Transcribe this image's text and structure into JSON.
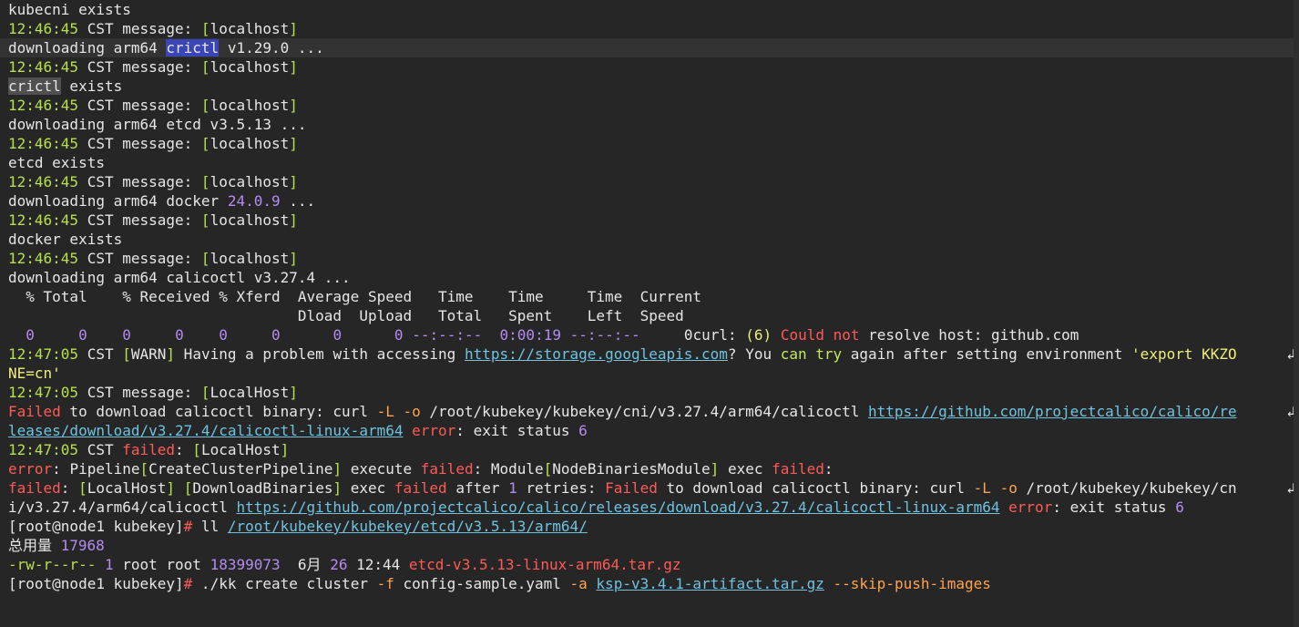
{
  "terminal": {
    "scrollbar": "vertical-scrollbar",
    "colors": {
      "background": "#262626",
      "text": "#e6e6e6",
      "timestamp": "#b8e04a",
      "error": "#ff5a55",
      "number": "#b48cf0",
      "link": "#6fc3df",
      "option": "#ffa34d",
      "green_word": "#c3e85c",
      "selection": "#3a45b8"
    },
    "lines": [
      [
        {
          "t": "kubecni exists"
        }
      ],
      [
        {
          "t": "12:46:45",
          "c": "t"
        },
        {
          "t": " CST message: "
        },
        {
          "t": "[",
          "c": "t"
        },
        {
          "t": "localhost"
        },
        {
          "t": "]",
          "c": "t"
        }
      ],
      [
        {
          "t": "downloading arm64 "
        },
        {
          "t": "crictl",
          "c": "sel"
        },
        {
          "t": " v1.29.0 ..."
        }
      ],
      [
        {
          "t": "12:46:45",
          "c": "t"
        },
        {
          "t": " CST message: "
        },
        {
          "t": "[",
          "c": "t"
        },
        {
          "t": "localhost"
        },
        {
          "t": "]",
          "c": "t"
        }
      ],
      [
        {
          "t": "crictl",
          "c": "sel2"
        },
        {
          "t": " exists"
        }
      ],
      [
        {
          "t": "12:46:45",
          "c": "t"
        },
        {
          "t": " CST message: "
        },
        {
          "t": "[",
          "c": "t"
        },
        {
          "t": "localhost"
        },
        {
          "t": "]",
          "c": "t"
        }
      ],
      [
        {
          "t": "downloading arm64 etcd v3.5.13 ..."
        }
      ],
      [
        {
          "t": "12:46:45",
          "c": "t"
        },
        {
          "t": " CST message: "
        },
        {
          "t": "[",
          "c": "t"
        },
        {
          "t": "localhost"
        },
        {
          "t": "]",
          "c": "t"
        }
      ],
      [
        {
          "t": "etcd exists"
        }
      ],
      [
        {
          "t": "12:46:45",
          "c": "t"
        },
        {
          "t": " CST message: "
        },
        {
          "t": "[",
          "c": "t"
        },
        {
          "t": "localhost"
        },
        {
          "t": "]",
          "c": "t"
        }
      ],
      [
        {
          "t": "downloading arm64 docker "
        },
        {
          "t": "24.0.9",
          "c": "p"
        },
        {
          "t": " ..."
        }
      ],
      [
        {
          "t": "12:46:45",
          "c": "t"
        },
        {
          "t": " CST message: "
        },
        {
          "t": "[",
          "c": "t"
        },
        {
          "t": "localhost"
        },
        {
          "t": "]",
          "c": "t"
        }
      ],
      [
        {
          "t": "docker exists"
        }
      ],
      [
        {
          "t": "12:46:45",
          "c": "t"
        },
        {
          "t": " CST message: "
        },
        {
          "t": "[",
          "c": "t"
        },
        {
          "t": "localhost"
        },
        {
          "t": "]",
          "c": "t"
        }
      ],
      [
        {
          "t": "downloading arm64 calicoctl v3.27.4 ..."
        }
      ],
      [
        {
          "t": "  % Total    % Received % Xferd  Average Speed   Time    Time     Time  Current"
        }
      ],
      [
        {
          "t": "                                 Dload  Upload   Total   Spent    Left  Speed"
        }
      ],
      [
        {
          "t": "  "
        },
        {
          "t": "0",
          "c": "p"
        },
        {
          "t": "     "
        },
        {
          "t": "0",
          "c": "p"
        },
        {
          "t": "    "
        },
        {
          "t": "0",
          "c": "p"
        },
        {
          "t": "     "
        },
        {
          "t": "0",
          "c": "p"
        },
        {
          "t": "    "
        },
        {
          "t": "0",
          "c": "p"
        },
        {
          "t": "     "
        },
        {
          "t": "0",
          "c": "p"
        },
        {
          "t": "      "
        },
        {
          "t": "0",
          "c": "p"
        },
        {
          "t": "      "
        },
        {
          "t": "0",
          "c": "p"
        },
        {
          "t": " "
        },
        {
          "t": "--:--:--",
          "c": "p"
        },
        {
          "t": "  "
        },
        {
          "t": "0:00:19",
          "c": "p"
        },
        {
          "t": " "
        },
        {
          "t": "--:--:--",
          "c": "p"
        },
        {
          "t": "     0curl: "
        },
        {
          "t": "(6)",
          "c": "y"
        },
        {
          "t": " "
        },
        {
          "t": "Could not",
          "c": "r"
        },
        {
          "t": " resolve host: github.com"
        }
      ],
      [
        {
          "t": "12:47:05",
          "c": "t"
        },
        {
          "t": " CST "
        },
        {
          "t": "[",
          "c": "t"
        },
        {
          "t": "WARN"
        },
        {
          "t": "]",
          "c": "t"
        },
        {
          "t": " Having a problem with accessing "
        },
        {
          "t": "https://storage.googleapis.com",
          "c": "l"
        },
        {
          "t": "? You "
        },
        {
          "t": "can try",
          "c": "g"
        },
        {
          "t": " again after setting environment "
        },
        {
          "t": "'export KKZO",
          "c": "y"
        }
      ],
      [
        {
          "t": "NE=cn'",
          "c": "y"
        }
      ],
      [
        {
          "t": "12:47:05",
          "c": "t"
        },
        {
          "t": " CST message: "
        },
        {
          "t": "[",
          "c": "t"
        },
        {
          "t": "LocalHost"
        },
        {
          "t": "]",
          "c": "t"
        }
      ],
      [
        {
          "t": "Failed",
          "c": "r"
        },
        {
          "t": " to download calicoctl binary: curl "
        },
        {
          "t": "-L -o",
          "c": "o"
        },
        {
          "t": " /root/kubekey/kubekey/cni/v3.27.4/arm64/calicoctl "
        },
        {
          "t": "https://github.com/projectcalico/calico/re",
          "c": "l"
        }
      ],
      [
        {
          "t": "leases/download/v3.27.4/calicoctl-linux-arm64",
          "c": "l"
        },
        {
          "t": " "
        },
        {
          "t": "error",
          "c": "r"
        },
        {
          "t": ": exit status "
        },
        {
          "t": "6",
          "c": "p"
        }
      ],
      [
        {
          "t": "12:47:05",
          "c": "t"
        },
        {
          "t": " CST "
        },
        {
          "t": "failed",
          "c": "r"
        },
        {
          "t": ": "
        },
        {
          "t": "[",
          "c": "t"
        },
        {
          "t": "LocalHost"
        },
        {
          "t": "]",
          "c": "t"
        }
      ],
      [
        {
          "t": "error",
          "c": "r"
        },
        {
          "t": ": Pipeline"
        },
        {
          "t": "[",
          "c": "t"
        },
        {
          "t": "CreateClusterPipeline"
        },
        {
          "t": "]",
          "c": "t"
        },
        {
          "t": " execute "
        },
        {
          "t": "failed",
          "c": "r"
        },
        {
          "t": ": Module"
        },
        {
          "t": "[",
          "c": "t"
        },
        {
          "t": "NodeBinariesModule"
        },
        {
          "t": "]",
          "c": "t"
        },
        {
          "t": " exec "
        },
        {
          "t": "failed",
          "c": "r"
        },
        {
          "t": ":"
        }
      ],
      [
        {
          "t": "failed",
          "c": "r"
        },
        {
          "t": ": "
        },
        {
          "t": "[",
          "c": "t"
        },
        {
          "t": "LocalHost"
        },
        {
          "t": "]",
          "c": "t"
        },
        {
          "t": " "
        },
        {
          "t": "[",
          "c": "t"
        },
        {
          "t": "DownloadBinaries"
        },
        {
          "t": "]",
          "c": "t"
        },
        {
          "t": " exec "
        },
        {
          "t": "failed",
          "c": "r"
        },
        {
          "t": " after "
        },
        {
          "t": "1",
          "c": "p"
        },
        {
          "t": " retries: "
        },
        {
          "t": "Failed",
          "c": "r"
        },
        {
          "t": " to download calicoctl binary: curl "
        },
        {
          "t": "-L -o",
          "c": "o"
        },
        {
          "t": " /root/kubekey/kubekey/cn"
        }
      ],
      [
        {
          "t": "i/v3.27.4/arm64/calicoctl "
        },
        {
          "t": "https://github.com/projectcalico/calico/releases/download/v3.27.4/calicoctl-linux-arm64",
          "c": "l"
        },
        {
          "t": " "
        },
        {
          "t": "error",
          "c": "r"
        },
        {
          "t": ": exit status "
        },
        {
          "t": "6",
          "c": "p"
        }
      ],
      [
        {
          "t": "[root@node1 kubekey]"
        },
        {
          "t": "#",
          "c": "r"
        },
        {
          "t": " ll "
        },
        {
          "t": "/root/kubekey/kubekey/etcd/v3.5.13/arm64/",
          "c": "l"
        }
      ],
      [
        {
          "t": "总用量 "
        },
        {
          "t": "17968",
          "c": "p"
        }
      ],
      [
        {
          "t": "-rw-r--r--",
          "c": "t"
        },
        {
          "t": " "
        },
        {
          "t": "1",
          "c": "p"
        },
        {
          "t": " root root "
        },
        {
          "t": "18399073",
          "c": "p"
        },
        {
          "t": "  6月 "
        },
        {
          "t": "26",
          "c": "p"
        },
        {
          "t": " 12:44 "
        },
        {
          "t": "etcd-v3.5.13-linux-arm64.tar.gz",
          "c": "r"
        }
      ],
      [
        {
          "t": "[root@node1 kubekey]"
        },
        {
          "t": "#",
          "c": "r"
        },
        {
          "t": " ./kk create cluster "
        },
        {
          "t": "-f",
          "c": "o"
        },
        {
          "t": " config-sample.yaml "
        },
        {
          "t": "-a",
          "c": "o"
        },
        {
          "t": " "
        },
        {
          "t": "ksp-v3.4.1-artifact.tar.gz",
          "c": "l"
        },
        {
          "t": " "
        },
        {
          "t": "--skip-push-images",
          "c": "o"
        }
      ]
    ],
    "highlight_line": 2,
    "wrapped_lines": [
      18,
      21,
      25
    ],
    "wrap_glyph": "↲"
  }
}
